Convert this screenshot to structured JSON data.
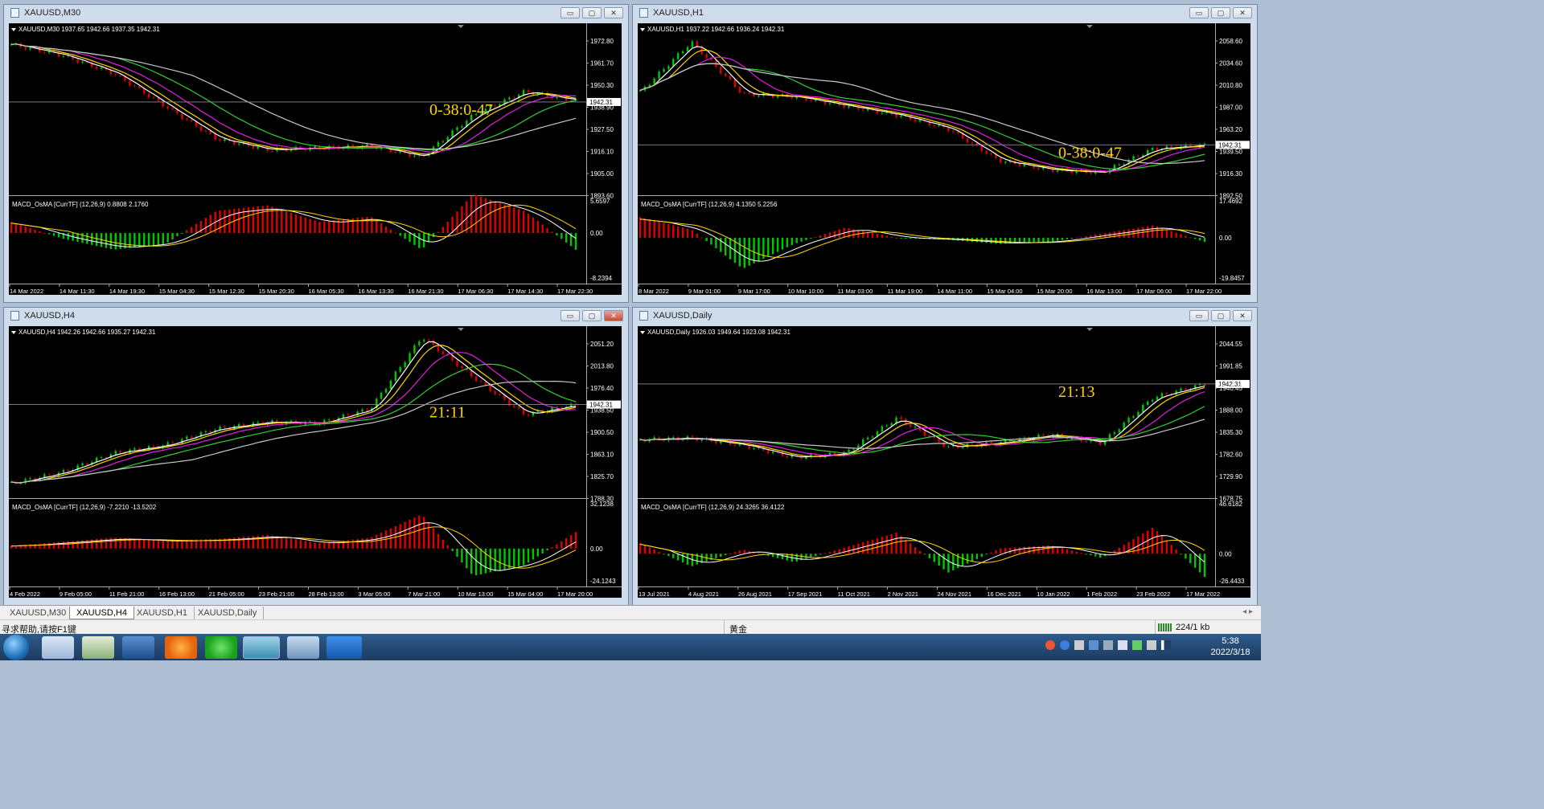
{
  "windows": [
    {
      "title": "XAUUSD,M30",
      "info": "XAUUSD,M30  1937.65 1942.66 1937.35 1942.31",
      "macd_info": "MACD_OsMA [CurrTF] (12,26,9) 0.8808 2.1760",
      "overlay": "0-38:0-47",
      "overlay_color": "#ffd400",
      "price_ticks": [
        "1972.80",
        "1961.70",
        "1950.30",
        "1938.90",
        "1927.50",
        "1916.10",
        "1905.00",
        "1893.60"
      ],
      "current_price": "1942.31",
      "macd_ticks": [
        "5.6597",
        "0.00",
        "-8.2394"
      ],
      "time_ticks": [
        "14 Mar 2022",
        "14 Mar 11:30",
        "14 Mar 19:30",
        "15 Mar 04:30",
        "15 Mar 12:30",
        "15 Mar 20:30",
        "16 Mar 05:30",
        "16 Mar 13:30",
        "16 Mar 21:30",
        "17 Mar 06:30",
        "17 Mar 14:30",
        "17 Mar 22:30"
      ],
      "chart_data": {
        "type": "line",
        "x": [
          "14 Mar 2022",
          "14 Mar 11:30",
          "14 Mar 19:30",
          "15 Mar 04:30",
          "15 Mar 12:30",
          "15 Mar 20:30",
          "16 Mar 05:30",
          "16 Mar 13:30",
          "16 Mar 21:30",
          "17 Mar 06:30",
          "17 Mar 14:30",
          "17 Mar 22:30"
        ],
        "series": [
          {
            "values": [
              1974,
              1968,
              1958,
              1940,
              1922,
              1916,
              1917,
              1918,
              1912,
              1935,
              1948,
              1943
            ]
          }
        ],
        "ylim": [
          1893.6,
          1983
        ],
        "macd": [
          2,
          -1,
          -3,
          -2,
          4,
          5,
          2,
          3,
          -3,
          7,
          4,
          -3
        ],
        "macd_range": [
          -8.2394,
          5.6597
        ]
      }
    },
    {
      "title": "XAUUSD,H1",
      "info": "XAUUSD,H1  1937.22 1942.66 1936.24 1942.31",
      "macd_info": "MACD_OsMA [CurrTF] (12,26,9) 4.1350 5.2256",
      "overlay": "0-38:0-47",
      "overlay_color": "#ffd400",
      "price_ticks": [
        "2058.60",
        "2034.60",
        "2010.80",
        "1987.00",
        "1963.20",
        "1939.50",
        "1916.30",
        "1892.50"
      ],
      "current_price": "1942.31",
      "macd_ticks": [
        "17.4692",
        "0.00",
        "-19.8457"
      ],
      "time_ticks": [
        "8 Mar 2022",
        "9 Mar 01:00",
        "9 Mar 17:00",
        "10 Mar 10:00",
        "11 Mar 03:00",
        "11 Mar 19:00",
        "14 Mar 11:00",
        "15 Mar 04:00",
        "15 Mar 20:00",
        "16 Mar 13:00",
        "17 Mar 06:00",
        "17 Mar 22:00"
      ],
      "chart_data": {
        "type": "line",
        "x": [
          "8 Mar 2022",
          "9 Mar 01:00",
          "9 Mar 17:00",
          "10 Mar 10:00",
          "11 Mar 03:00",
          "11 Mar 19:00",
          "14 Mar 11:00",
          "15 Mar 04:00",
          "15 Mar 20:00",
          "16 Mar 13:00",
          "17 Mar 06:00",
          "17 Mar 22:00"
        ],
        "series": [
          {
            "values": [
              2000,
              2055,
              1998,
              1995,
              1985,
              1975,
              1960,
              1925,
              1915,
              1912,
              1938,
              1942
            ]
          }
        ],
        "ylim": [
          1892.5,
          2070
        ],
        "macd": [
          10,
          4,
          -15,
          -3,
          5,
          0,
          -1,
          -3,
          -2,
          2,
          6,
          -2
        ],
        "macd_range": [
          -19.8457,
          17.4692
        ]
      }
    },
    {
      "title": "XAUUSD,H4",
      "info": "XAUUSD,H4  1942.26 1942.66 1935.27 1942.31",
      "macd_info": "MACD_OsMA [CurrTF] (12,26,9) -7.2210 -13.5202",
      "overlay": "21:11",
      "overlay_color": "#ffd400",
      "price_ticks": [
        "2051.20",
        "2013.80",
        "1976.40",
        "1938.50",
        "1900.50",
        "1863.10",
        "1825.70",
        "1788.30"
      ],
      "current_price": "1942.31",
      "macd_ticks": [
        "32.1238",
        "0.00",
        "-24.1243"
      ],
      "time_ticks": [
        "4 Feb 2022",
        "9 Feb 05:00",
        "11 Feb 21:00",
        "16 Feb 13:00",
        "21 Feb 05:00",
        "23 Feb 21:00",
        "28 Feb 13:00",
        "3 Mar 05:00",
        "7 Mar 21:00",
        "10 Mar 13:00",
        "15 Mar 04:00",
        "17 Mar 20:00"
      ],
      "chart_data": {
        "type": "line",
        "x": [
          "4 Feb 2022",
          "9 Feb 05:00",
          "11 Feb 21:00",
          "16 Feb 13:00",
          "21 Feb 05:00",
          "23 Feb 21:00",
          "28 Feb 13:00",
          "3 Mar 05:00",
          "7 Mar 21:00",
          "10 Mar 13:00",
          "15 Mar 04:00",
          "17 Mar 20:00"
        ],
        "series": [
          {
            "values": [
              1805,
              1825,
              1858,
              1872,
              1900,
              1912,
              1910,
              1935,
              2060,
              1990,
              1925,
              1942
            ]
          }
        ],
        "ylim": [
          1788.3,
          2070
        ],
        "macd": [
          2,
          5,
          8,
          6,
          7,
          10,
          4,
          8,
          25,
          -20,
          -12,
          12
        ],
        "macd_range": [
          -24.1243,
          32.1238
        ]
      }
    },
    {
      "title": "XAUUSD,Daily",
      "info": "XAUUSD,Daily  1926.03 1949.64 1923.08 1942.31",
      "macd_info": "MACD_OsMA [CurrTF] (12,26,9) 24.3265 36.4122",
      "overlay": "21:13",
      "overlay_color": "#ffd400",
      "price_ticks": [
        "2044.55",
        "1991.85",
        "1940.45",
        "1888.00",
        "1835.30",
        "1782.60",
        "1729.90",
        "1678.75"
      ],
      "current_price": "1942.31",
      "macd_ticks": [
        "46.6182",
        "0.00",
        "-26.4433"
      ],
      "time_ticks": [
        "13 Jul 2021",
        "4 Aug 2021",
        "26 Aug 2021",
        "17 Sep 2021",
        "11 Oct 2021",
        "2 Nov 2021",
        "24 Nov 2021",
        "16 Dec 2021",
        "10 Jan 2022",
        "1 Feb 2022",
        "23 Feb 2022",
        "17 Mar 2022"
      ],
      "chart_data": {
        "type": "line",
        "x": [
          "13 Jul 2021",
          "4 Aug 2021",
          "26 Aug 2021",
          "17 Sep 2021",
          "11 Oct 2021",
          "2 Nov 2021",
          "24 Nov 2021",
          "16 Dec 2021",
          "10 Jan 2022",
          "1 Feb 2022",
          "23 Feb 2022",
          "17 Mar 2022"
        ],
        "series": [
          {
            "values": [
              1808,
              1812,
              1795,
              1765,
              1775,
              1860,
              1790,
              1800,
              1820,
              1800,
              1910,
              1942
            ]
          }
        ],
        "ylim": [
          1678.75,
          2070
        ],
        "macd": [
          10,
          -12,
          4,
          -8,
          6,
          20,
          -18,
          5,
          8,
          -4,
          25,
          -22
        ],
        "macd_range": [
          -26.4433,
          46.6182
        ]
      }
    }
  ],
  "tabs": [
    "XAUUSD,M30",
    "XAUUSD,H4",
    "XAUUSD,H1",
    "XAUUSD,Daily"
  ],
  "active_tab": 1,
  "status": {
    "help": "寻求帮助,请按F1键",
    "profile": "黄金",
    "traffic": "224/1 kb"
  },
  "clock": {
    "time": "5:38",
    "date": "2022/3/18"
  },
  "window_buttons": {
    "min": "▭",
    "max": "▢",
    "close": "✕"
  }
}
